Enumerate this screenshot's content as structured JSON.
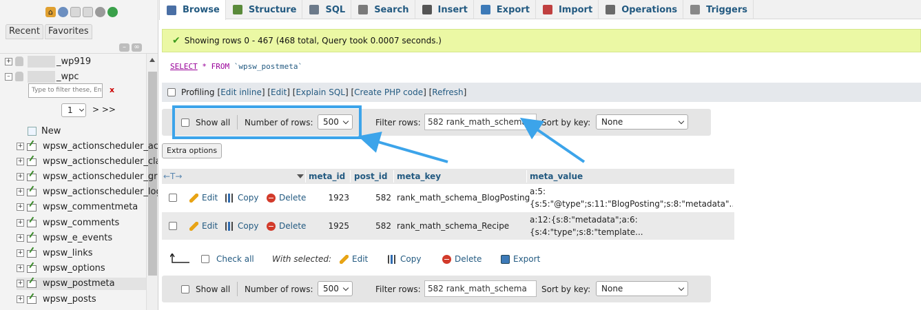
{
  "sidebar": {
    "tabs": [
      "Recent",
      "Favorites"
    ],
    "databases": [
      {
        "suffix": "_wp919"
      },
      {
        "suffix": "_wpc"
      }
    ],
    "filter_placeholder": "Type to filter these, Enter",
    "filter_clear": "x",
    "page_select": "1",
    "page_next": "> >>",
    "new_label": "New",
    "tables": [
      "wpsw_actionscheduler_ac",
      "wpsw_actionscheduler_cla",
      "wpsw_actionscheduler_gro",
      "wpsw_actionscheduler_log",
      "wpsw_commentmeta",
      "wpsw_comments",
      "wpsw_e_events",
      "wpsw_links",
      "wpsw_options",
      "wpsw_postmeta",
      "wpsw_posts"
    ],
    "active_table": "wpsw_postmeta"
  },
  "tabs": [
    {
      "label": "Browse",
      "icon": "browse-icon",
      "color": "#4a6fa5"
    },
    {
      "label": "Structure",
      "icon": "structure-icon",
      "color": "#5a8a3a"
    },
    {
      "label": "SQL",
      "icon": "sql-icon",
      "color": "#6c7a8a"
    },
    {
      "label": "Search",
      "icon": "search-icon",
      "color": "#7a7a7a"
    },
    {
      "label": "Insert",
      "icon": "insert-icon",
      "color": "#555555"
    },
    {
      "label": "Export",
      "icon": "export-icon",
      "color": "#3d7ab8"
    },
    {
      "label": "Import",
      "icon": "import-icon",
      "color": "#c04040"
    },
    {
      "label": "Operations",
      "icon": "operations-icon",
      "color": "#6a6a6a"
    },
    {
      "label": "Triggers",
      "icon": "triggers-icon",
      "color": "#888888"
    }
  ],
  "success_message": "Showing rows 0 - 467 (468 total, Query took 0.0007 seconds.)",
  "sql": {
    "select": "SELECT",
    "star": "*",
    "from": "FROM",
    "table": "`wpsw_postmeta`"
  },
  "profiling": {
    "label": "Profiling",
    "links": [
      "Edit inline",
      "Edit",
      "Explain SQL",
      "Create PHP code",
      "Refresh"
    ]
  },
  "nav": {
    "show_all": "Show all",
    "num_rows_label": "Number of rows:",
    "num_rows": "500",
    "filter_label": "Filter rows:",
    "filter_value": "582 rank_math_schema",
    "sort_label": "Sort by key:",
    "sort_value": "None"
  },
  "extra_options": "Extra options",
  "table": {
    "columns": [
      "meta_id",
      "post_id",
      "meta_key",
      "meta_value"
    ],
    "rows": [
      {
        "meta_id": "1923",
        "post_id": "582",
        "meta_key": "rank_math_schema_BlogPosting",
        "meta_value_1": "a:5:",
        "meta_value_2": "{s:5:\"@type\";s:11:\"BlogPosting\";s:8:\"metadata\"..."
      },
      {
        "meta_id": "1925",
        "post_id": "582",
        "meta_key": "rank_math_schema_Recipe",
        "meta_value_1": "a:12:{s:8:\"metadata\";a:6:",
        "meta_value_2": "{s:4:\"type\";s:8:\"template..."
      }
    ],
    "row_actions": [
      "Edit",
      "Copy",
      "Delete"
    ]
  },
  "bottom": {
    "check_all": "Check all",
    "with_selected": "With selected:",
    "actions": [
      "Edit",
      "Copy",
      "Delete",
      "Export"
    ]
  },
  "colors": {
    "link": "#235a81",
    "success_bg": "#ebf8a4",
    "highlight": "#3ca4ea"
  }
}
